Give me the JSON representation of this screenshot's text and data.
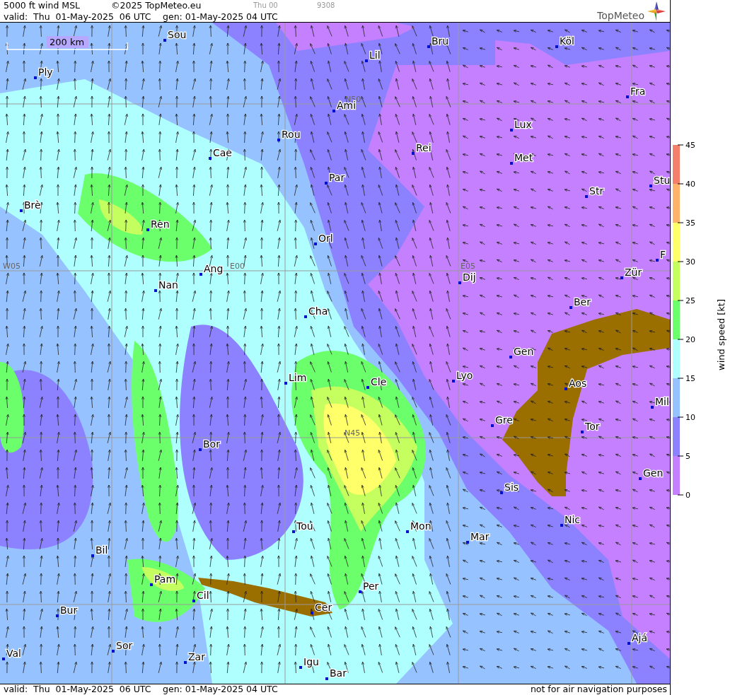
{
  "header": {
    "title": "5000 ft wind MSL",
    "copyright": "©2025 TopMeteo.eu",
    "run": "Thu 00",
    "code": "9308",
    "valid": "valid:  Thu  01-May-2025  06 UTC",
    "generated": "gen: 01-May-2025 04 UTC",
    "logo": "TopMeteo"
  },
  "map": {
    "scale": "200 km",
    "grid_labels": [
      "N50",
      "W05",
      "E00",
      "E05",
      "N45"
    ],
    "cities": [
      "Sou",
      "Bru",
      "Köl",
      "Ply",
      "Lil",
      "Ami",
      "Fra",
      "Rou",
      "Lux",
      "Cae",
      "Rei",
      "Met",
      "Par",
      "Stu",
      "Str",
      "Brè",
      "Ren",
      "Orl",
      "F",
      "Ang",
      "Zür",
      "Nan",
      "Dij",
      "Ber",
      "Cha",
      "Gen",
      "Lim",
      "Lyo",
      "Cle",
      "Aos",
      "Mil",
      "Gre",
      "Tor",
      "Bor",
      "Gen",
      "Sis",
      "Nic",
      "Tou",
      "Mon",
      "Mar",
      "Bil",
      "Pam",
      "Per",
      "Cil",
      "Cer",
      "Bur",
      "Ajá",
      "Sor",
      "Val",
      "Zar",
      "Igu",
      "Bar"
    ]
  },
  "legend": {
    "title": "wind speed [kt]",
    "ticks": [
      "45",
      "40",
      "35",
      "30",
      "25",
      "20",
      "15",
      "10",
      "5",
      "0"
    ],
    "bands": [
      {
        "color": "#f47f6a"
      },
      {
        "color": "#ffb26a"
      },
      {
        "color": "#ffff6a"
      },
      {
        "color": "#c4ff5f"
      },
      {
        "color": "#6cff6c"
      },
      {
        "color": "#b0ffff"
      },
      {
        "color": "#96c3ff"
      },
      {
        "color": "#8c82ff"
      },
      {
        "color": "#c580ff"
      }
    ]
  },
  "footer": {
    "valid": "valid:  Thu  01-May-2025  06 UTC",
    "generated": "gen: 01-May-2025 04 UTC",
    "notice": "not for air navigation purposes"
  }
}
